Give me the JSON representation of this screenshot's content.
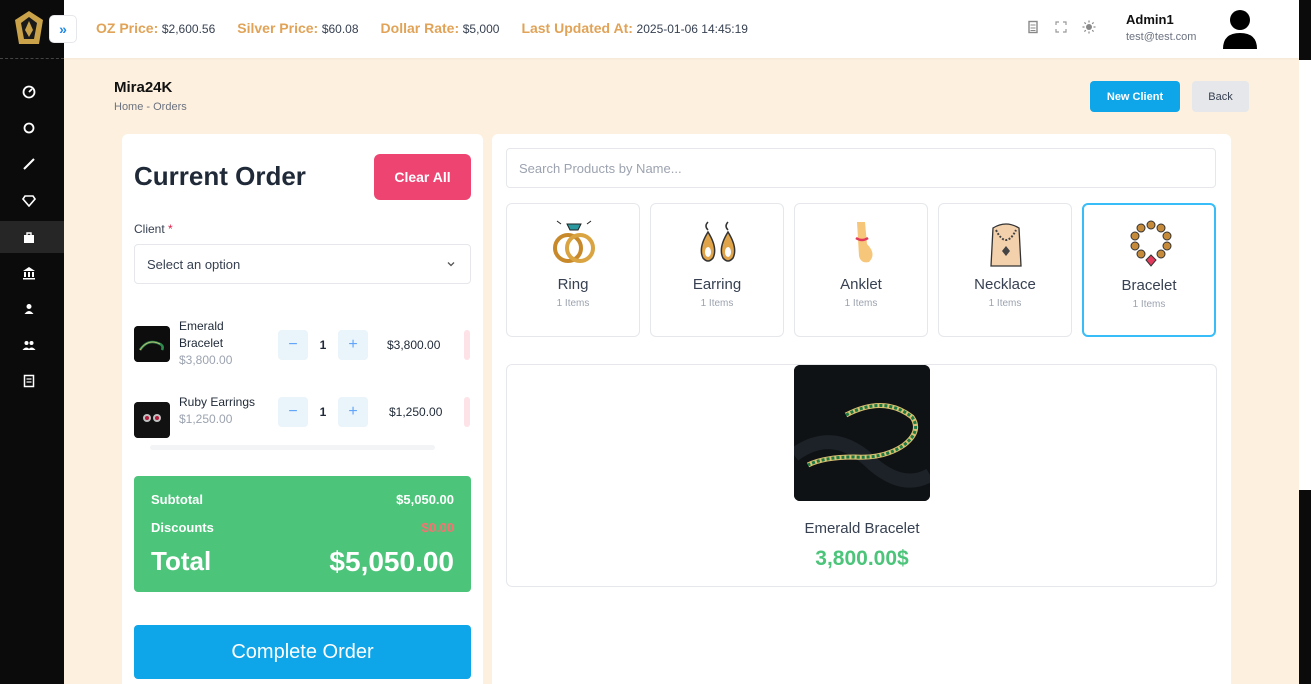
{
  "topbar": {
    "prices": [
      {
        "label": "OZ Price:",
        "value": "$2,600.56"
      },
      {
        "label": "Silver Price:",
        "value": "$60.08"
      },
      {
        "label": "Dollar Rate:",
        "value": "$5,000"
      },
      {
        "label": "Last Updated At:",
        "value": "2025-01-06 14:45:19"
      }
    ],
    "toggle_icon": "»",
    "admin_name": "Admin1",
    "admin_email": "test@test.com"
  },
  "sidebar": {
    "items": [
      {
        "icon": "dashboard-icon"
      },
      {
        "icon": "circle-icon"
      },
      {
        "icon": "brush-icon"
      },
      {
        "icon": "diamond-icon"
      },
      {
        "icon": "bag-icon",
        "active": true
      },
      {
        "icon": "bank-icon"
      },
      {
        "icon": "user-icon"
      },
      {
        "icon": "users-icon"
      },
      {
        "icon": "report-icon"
      }
    ]
  },
  "page": {
    "title": "Mira24K",
    "breadcrumb": "Home  -  Orders",
    "new_client_label": "New Client",
    "back_label": "Back"
  },
  "order": {
    "title": "Current Order",
    "clear_label": "Clear All",
    "client_label": "Client",
    "client_required": "*",
    "client_placeholder": "Select an option",
    "items": [
      {
        "name": "Emerald Bracelet",
        "unit_price": "$3,800.00",
        "qty": "1",
        "total": "$3,800.00"
      },
      {
        "name": "Ruby Earrings",
        "unit_price": "$1,250.00",
        "qty": "1",
        "total": "$1,250.00"
      }
    ],
    "minus": "−",
    "plus": "+",
    "subtotal_label": "Subtotal",
    "subtotal_value": "$5,050.00",
    "discounts_label": "Discounts",
    "discounts_value": "$0.00",
    "total_label": "Total",
    "total_value": "$5,050.00",
    "complete_label": "Complete Order"
  },
  "products": {
    "search_placeholder": "Search Products by Name...",
    "categories": [
      {
        "name": "Ring",
        "count": "1 Items"
      },
      {
        "name": "Earring",
        "count": "1 Items"
      },
      {
        "name": "Anklet",
        "count": "1 Items"
      },
      {
        "name": "Necklace",
        "count": "1 Items"
      },
      {
        "name": "Bracelet",
        "count": "1 Items",
        "active": true
      }
    ],
    "featured": {
      "name": "Emerald Bracelet",
      "price": "3,800.00$"
    }
  },
  "colors": {
    "accent_blue": "#0ea5e9",
    "danger_pink": "#ee4472",
    "success_green": "#4cc47a",
    "gold": "#e0a357"
  }
}
